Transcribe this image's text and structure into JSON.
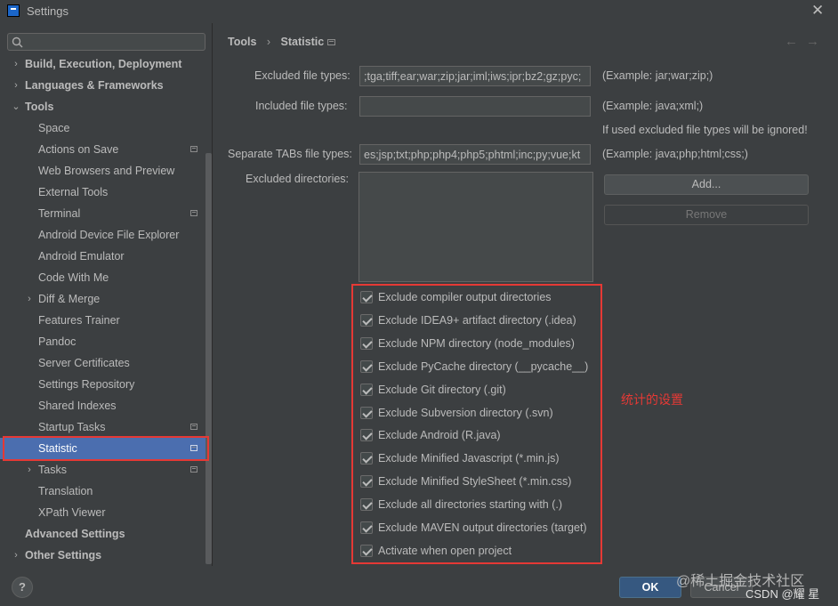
{
  "window": {
    "title": "Settings"
  },
  "search": {
    "placeholder": ""
  },
  "sidebar": {
    "items": [
      {
        "label": "Build, Execution, Deployment",
        "bold": true,
        "arrow": "›",
        "level": 0,
        "proj": false
      },
      {
        "label": "Languages & Frameworks",
        "bold": true,
        "arrow": "›",
        "level": 0,
        "proj": false
      },
      {
        "label": "Tools",
        "bold": true,
        "arrow": "⌄",
        "level": 0,
        "proj": false
      },
      {
        "label": "Space",
        "level": 1,
        "proj": false
      },
      {
        "label": "Actions on Save",
        "level": 1,
        "proj": true
      },
      {
        "label": "Web Browsers and Preview",
        "level": 1,
        "proj": false
      },
      {
        "label": "External Tools",
        "level": 1,
        "proj": false
      },
      {
        "label": "Terminal",
        "level": 1,
        "proj": true
      },
      {
        "label": "Android Device File Explorer",
        "level": 1,
        "proj": false
      },
      {
        "label": "Android Emulator",
        "level": 1,
        "proj": false
      },
      {
        "label": "Code With Me",
        "level": 1,
        "proj": false
      },
      {
        "label": "Diff & Merge",
        "arrow": "›",
        "level": 1,
        "proj": false
      },
      {
        "label": "Features Trainer",
        "level": 1,
        "proj": false
      },
      {
        "label": "Pandoc",
        "level": 1,
        "proj": false
      },
      {
        "label": "Server Certificates",
        "level": 1,
        "proj": false
      },
      {
        "label": "Settings Repository",
        "level": 1,
        "proj": false
      },
      {
        "label": "Shared Indexes",
        "level": 1,
        "proj": false
      },
      {
        "label": "Startup Tasks",
        "level": 1,
        "proj": true
      },
      {
        "label": "Statistic",
        "level": 1,
        "proj": true,
        "selected": true
      },
      {
        "label": "Tasks",
        "arrow": "›",
        "level": 1,
        "proj": true
      },
      {
        "label": "Translation",
        "level": 1,
        "proj": false
      },
      {
        "label": "XPath Viewer",
        "level": 1,
        "proj": false
      },
      {
        "label": "Advanced Settings",
        "bold": true,
        "level": 0,
        "proj": false
      },
      {
        "label": "Other Settings",
        "bold": true,
        "arrow": "›",
        "level": 0,
        "proj": false
      }
    ]
  },
  "breadcrumb": {
    "parent": "Tools",
    "sep": "›",
    "current": "Statistic"
  },
  "form": {
    "excluded_label": "Excluded file types:",
    "excluded_value": ";tga;tiff;ear;war;zip;jar;iml;iws;ipr;bz2;gz;pyc;",
    "excluded_hint": "(Example: jar;war;zip;)",
    "included_label": "Included file types:",
    "included_value": "",
    "included_hint": "(Example: java;xml;)",
    "ignored_note": "If used excluded file types will be ignored!",
    "tabs_label": "Separate TABs file types:",
    "tabs_value": "es;jsp;txt;php;php4;php5;phtml;inc;py;vue;kt",
    "tabs_hint": "(Example: java;php;html;css;)",
    "dirs_label": "Excluded directories:",
    "add_label": "Add...",
    "remove_label": "Remove"
  },
  "checkboxes": [
    {
      "label": "Exclude compiler output directories",
      "checked": true
    },
    {
      "label": "Exclude IDEA9+ artifact directory (.idea)",
      "checked": true
    },
    {
      "label": "Exclude NPM directory (node_modules)",
      "checked": true
    },
    {
      "label": "Exclude PyCache directory (__pycache__)",
      "checked": true
    },
    {
      "label": "Exclude Git directory (.git)",
      "checked": true
    },
    {
      "label": "Exclude Subversion directory (.svn)",
      "checked": true
    },
    {
      "label": "Exclude Android (R.java)",
      "checked": true
    },
    {
      "label": "Exclude Minified Javascript (*.min.js)",
      "checked": true
    },
    {
      "label": "Exclude Minified StyleSheet (*.min.css)",
      "checked": true
    },
    {
      "label": "Exclude all directories starting with (.)",
      "checked": true
    },
    {
      "label": "Exclude MAVEN output directories (target)",
      "checked": true
    },
    {
      "label": "Activate when open project",
      "checked": true
    }
  ],
  "annotation": "统计的设置",
  "footer": {
    "help": "?",
    "ok": "OK",
    "cancel": "Cancel",
    "watermark1": "@稀土掘金技术社区",
    "watermark2": "CSDN @耀 星"
  },
  "colors": {
    "accent": "#4b6eaf",
    "highlight": "#e53935",
    "ok": "#365880"
  }
}
